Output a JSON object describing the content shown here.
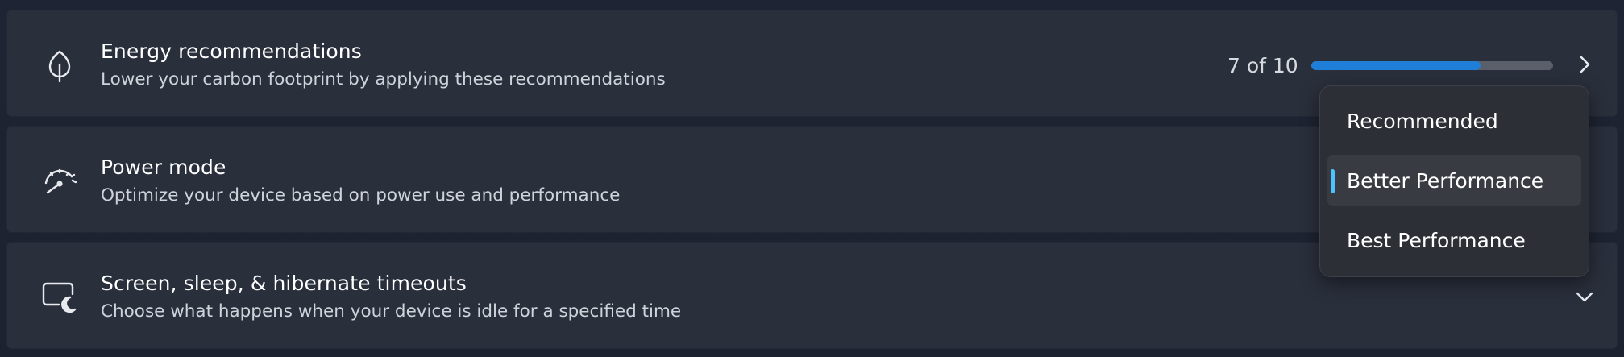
{
  "settings": {
    "energy": {
      "title": "Energy recommendations",
      "subtitle": "Lower your carbon footprint by applying these recommendations",
      "icon": "leaf-icon",
      "progress_text": "7 of 10",
      "progress_value": 0.7
    },
    "power_mode": {
      "title": "Power mode",
      "subtitle": "Optimize your device based on power use and performance",
      "icon": "gauge-icon"
    },
    "timeouts": {
      "title": "Screen, sleep, & hibernate timeouts",
      "subtitle": "Choose what happens when your device is idle for a specified time",
      "icon": "screen-sleep-icon"
    }
  },
  "power_mode_dropdown": {
    "options": [
      {
        "label": "Recommended",
        "selected": false
      },
      {
        "label": "Better Performance",
        "selected": true
      },
      {
        "label": "Best Performance",
        "selected": false
      }
    ]
  },
  "colors": {
    "accent": "#4cc2ff",
    "progress_fill": "#1f7ed8",
    "progress_track": "#5a5f69",
    "card_background": "#2a2f3c"
  }
}
